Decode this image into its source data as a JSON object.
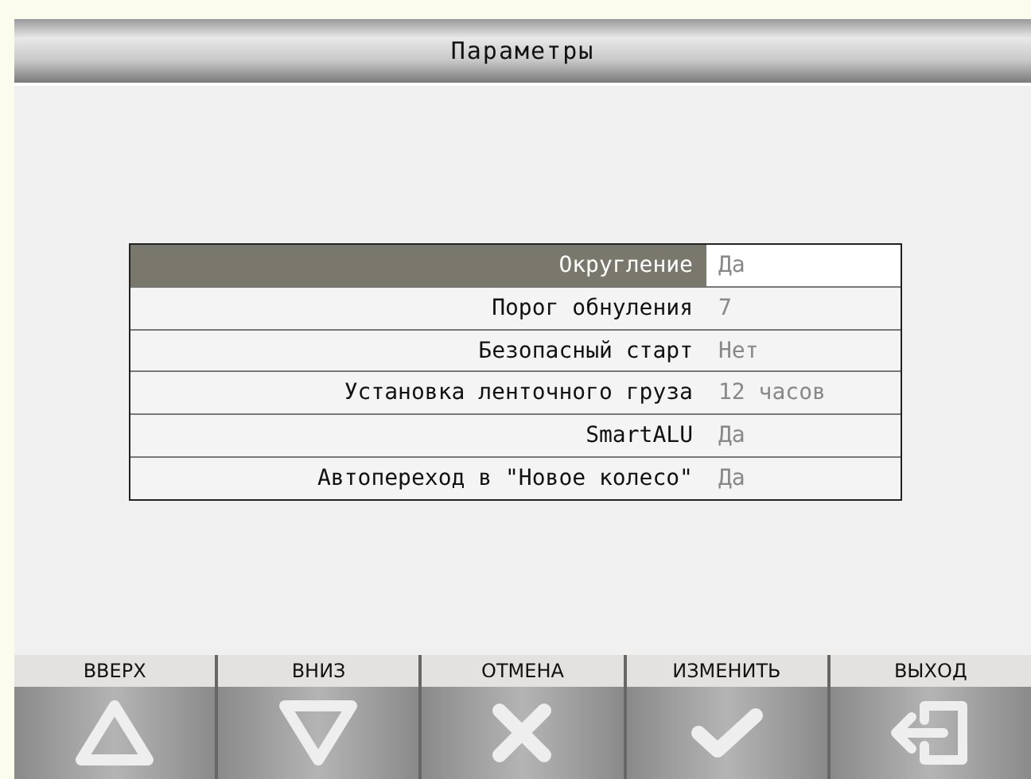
{
  "window": {
    "title": "Параметры"
  },
  "settings": [
    {
      "label": "Округление",
      "value": "Да",
      "selected": true
    },
    {
      "label": "Порог обнуления",
      "value": "7",
      "selected": false
    },
    {
      "label": "Безопасный старт",
      "value": "Нет",
      "selected": false
    },
    {
      "label": "Установка ленточного груза",
      "value": "12 часов",
      "selected": false
    },
    {
      "label": "SmartALU",
      "value": "Да",
      "selected": false
    },
    {
      "label": "Автопереход в \"Новое колесо\"",
      "value": "Да",
      "selected": false
    }
  ],
  "buttons": [
    {
      "label": "ВВЕРХ",
      "kind": "up"
    },
    {
      "label": "ВНИЗ",
      "kind": "down"
    },
    {
      "label": "ОТМЕНА",
      "kind": "cancel"
    },
    {
      "label": "ИЗМЕНИТЬ",
      "kind": "confirm"
    },
    {
      "label": "ВЫХОД",
      "kind": "exit"
    }
  ]
}
